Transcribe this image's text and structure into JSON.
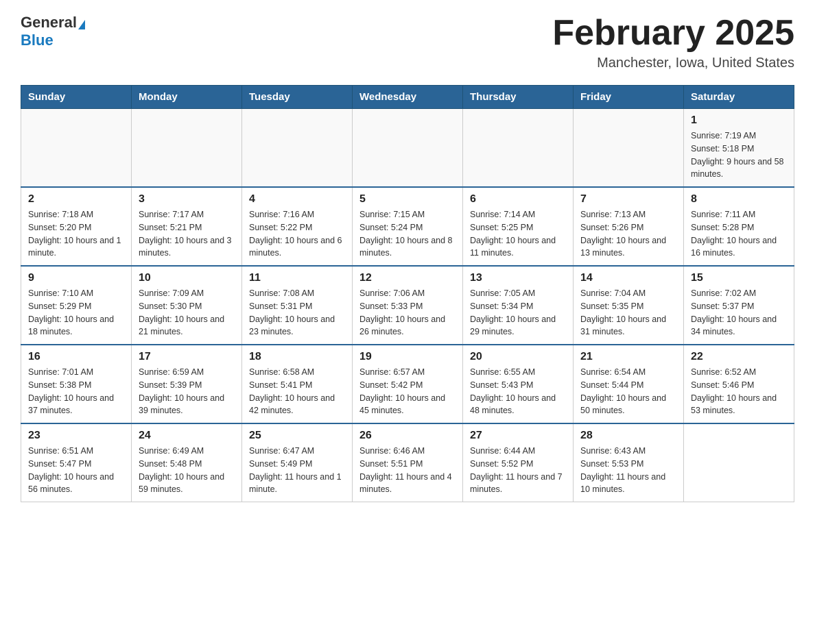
{
  "header": {
    "logo_general": "General",
    "logo_blue": "Blue",
    "month_year": "February 2025",
    "location": "Manchester, Iowa, United States"
  },
  "weekdays": [
    "Sunday",
    "Monday",
    "Tuesday",
    "Wednesday",
    "Thursday",
    "Friday",
    "Saturday"
  ],
  "weeks": [
    {
      "days": [
        {
          "num": "",
          "info": ""
        },
        {
          "num": "",
          "info": ""
        },
        {
          "num": "",
          "info": ""
        },
        {
          "num": "",
          "info": ""
        },
        {
          "num": "",
          "info": ""
        },
        {
          "num": "",
          "info": ""
        },
        {
          "num": "1",
          "info": "Sunrise: 7:19 AM\nSunset: 5:18 PM\nDaylight: 9 hours and 58 minutes."
        }
      ]
    },
    {
      "days": [
        {
          "num": "2",
          "info": "Sunrise: 7:18 AM\nSunset: 5:20 PM\nDaylight: 10 hours and 1 minute."
        },
        {
          "num": "3",
          "info": "Sunrise: 7:17 AM\nSunset: 5:21 PM\nDaylight: 10 hours and 3 minutes."
        },
        {
          "num": "4",
          "info": "Sunrise: 7:16 AM\nSunset: 5:22 PM\nDaylight: 10 hours and 6 minutes."
        },
        {
          "num": "5",
          "info": "Sunrise: 7:15 AM\nSunset: 5:24 PM\nDaylight: 10 hours and 8 minutes."
        },
        {
          "num": "6",
          "info": "Sunrise: 7:14 AM\nSunset: 5:25 PM\nDaylight: 10 hours and 11 minutes."
        },
        {
          "num": "7",
          "info": "Sunrise: 7:13 AM\nSunset: 5:26 PM\nDaylight: 10 hours and 13 minutes."
        },
        {
          "num": "8",
          "info": "Sunrise: 7:11 AM\nSunset: 5:28 PM\nDaylight: 10 hours and 16 minutes."
        }
      ]
    },
    {
      "days": [
        {
          "num": "9",
          "info": "Sunrise: 7:10 AM\nSunset: 5:29 PM\nDaylight: 10 hours and 18 minutes."
        },
        {
          "num": "10",
          "info": "Sunrise: 7:09 AM\nSunset: 5:30 PM\nDaylight: 10 hours and 21 minutes."
        },
        {
          "num": "11",
          "info": "Sunrise: 7:08 AM\nSunset: 5:31 PM\nDaylight: 10 hours and 23 minutes."
        },
        {
          "num": "12",
          "info": "Sunrise: 7:06 AM\nSunset: 5:33 PM\nDaylight: 10 hours and 26 minutes."
        },
        {
          "num": "13",
          "info": "Sunrise: 7:05 AM\nSunset: 5:34 PM\nDaylight: 10 hours and 29 minutes."
        },
        {
          "num": "14",
          "info": "Sunrise: 7:04 AM\nSunset: 5:35 PM\nDaylight: 10 hours and 31 minutes."
        },
        {
          "num": "15",
          "info": "Sunrise: 7:02 AM\nSunset: 5:37 PM\nDaylight: 10 hours and 34 minutes."
        }
      ]
    },
    {
      "days": [
        {
          "num": "16",
          "info": "Sunrise: 7:01 AM\nSunset: 5:38 PM\nDaylight: 10 hours and 37 minutes."
        },
        {
          "num": "17",
          "info": "Sunrise: 6:59 AM\nSunset: 5:39 PM\nDaylight: 10 hours and 39 minutes."
        },
        {
          "num": "18",
          "info": "Sunrise: 6:58 AM\nSunset: 5:41 PM\nDaylight: 10 hours and 42 minutes."
        },
        {
          "num": "19",
          "info": "Sunrise: 6:57 AM\nSunset: 5:42 PM\nDaylight: 10 hours and 45 minutes."
        },
        {
          "num": "20",
          "info": "Sunrise: 6:55 AM\nSunset: 5:43 PM\nDaylight: 10 hours and 48 minutes."
        },
        {
          "num": "21",
          "info": "Sunrise: 6:54 AM\nSunset: 5:44 PM\nDaylight: 10 hours and 50 minutes."
        },
        {
          "num": "22",
          "info": "Sunrise: 6:52 AM\nSunset: 5:46 PM\nDaylight: 10 hours and 53 minutes."
        }
      ]
    },
    {
      "days": [
        {
          "num": "23",
          "info": "Sunrise: 6:51 AM\nSunset: 5:47 PM\nDaylight: 10 hours and 56 minutes."
        },
        {
          "num": "24",
          "info": "Sunrise: 6:49 AM\nSunset: 5:48 PM\nDaylight: 10 hours and 59 minutes."
        },
        {
          "num": "25",
          "info": "Sunrise: 6:47 AM\nSunset: 5:49 PM\nDaylight: 11 hours and 1 minute."
        },
        {
          "num": "26",
          "info": "Sunrise: 6:46 AM\nSunset: 5:51 PM\nDaylight: 11 hours and 4 minutes."
        },
        {
          "num": "27",
          "info": "Sunrise: 6:44 AM\nSunset: 5:52 PM\nDaylight: 11 hours and 7 minutes."
        },
        {
          "num": "28",
          "info": "Sunrise: 6:43 AM\nSunset: 5:53 PM\nDaylight: 11 hours and 10 minutes."
        },
        {
          "num": "",
          "info": ""
        }
      ]
    }
  ]
}
